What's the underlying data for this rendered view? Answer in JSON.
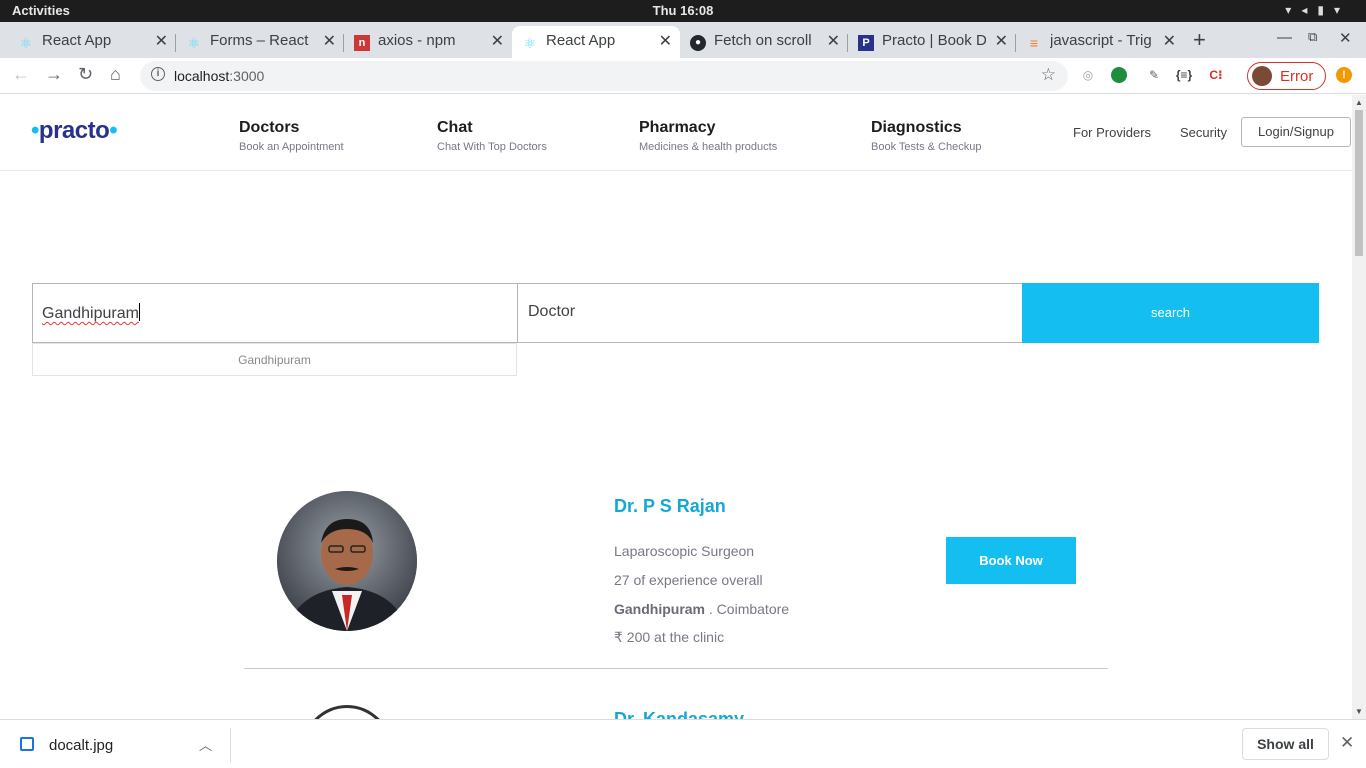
{
  "system": {
    "activities": "Activities",
    "clock": "Thu 16:08"
  },
  "browser": {
    "tabs": [
      {
        "title": "React App",
        "icon": "react-icon"
      },
      {
        "title": "Forms – React",
        "icon": "react-icon"
      },
      {
        "title": "axios - npm",
        "icon": "npm-icon"
      },
      {
        "title": "React App",
        "icon": "react-icon",
        "active": true
      },
      {
        "title": "Fetch on scroll",
        "icon": "github-icon"
      },
      {
        "title": "Practo | Book D",
        "icon": "practo-icon"
      },
      {
        "title": "javascript - Trig",
        "icon": "stackoverflow-icon"
      }
    ],
    "url_host": "localhost",
    "url_port": ":3000",
    "profile_error": "Error",
    "accent": "#14bef0"
  },
  "header": {
    "logo": "practo",
    "nav": [
      {
        "title": "Doctors",
        "subtitle": "Book an Appointment"
      },
      {
        "title": "Chat",
        "subtitle": "Chat With Top Doctors"
      },
      {
        "title": "Pharmacy",
        "subtitle": "Medicines & health products"
      },
      {
        "title": "Diagnostics",
        "subtitle": "Book Tests & Checkup"
      }
    ],
    "for_providers": "For Providers",
    "security": "Security",
    "login": "Login/Signup"
  },
  "search": {
    "location_value": "Gandhipuram",
    "query_value": "Doctor",
    "button": "search",
    "suggestion": "Gandhipuram"
  },
  "doctors": [
    {
      "name": "Dr. P S Rajan",
      "specialty": "Laparoscopic Surgeon",
      "experience": "27 of experience overall",
      "locality": "Gandhipuram",
      "city": " . Coimbatore",
      "fee": "₹ 200 at the clinic",
      "book": "Book Now"
    },
    {
      "name": "Dr. Kandasamy"
    }
  ],
  "downloads": {
    "file": "docalt.jpg",
    "show_all": "Show all"
  }
}
